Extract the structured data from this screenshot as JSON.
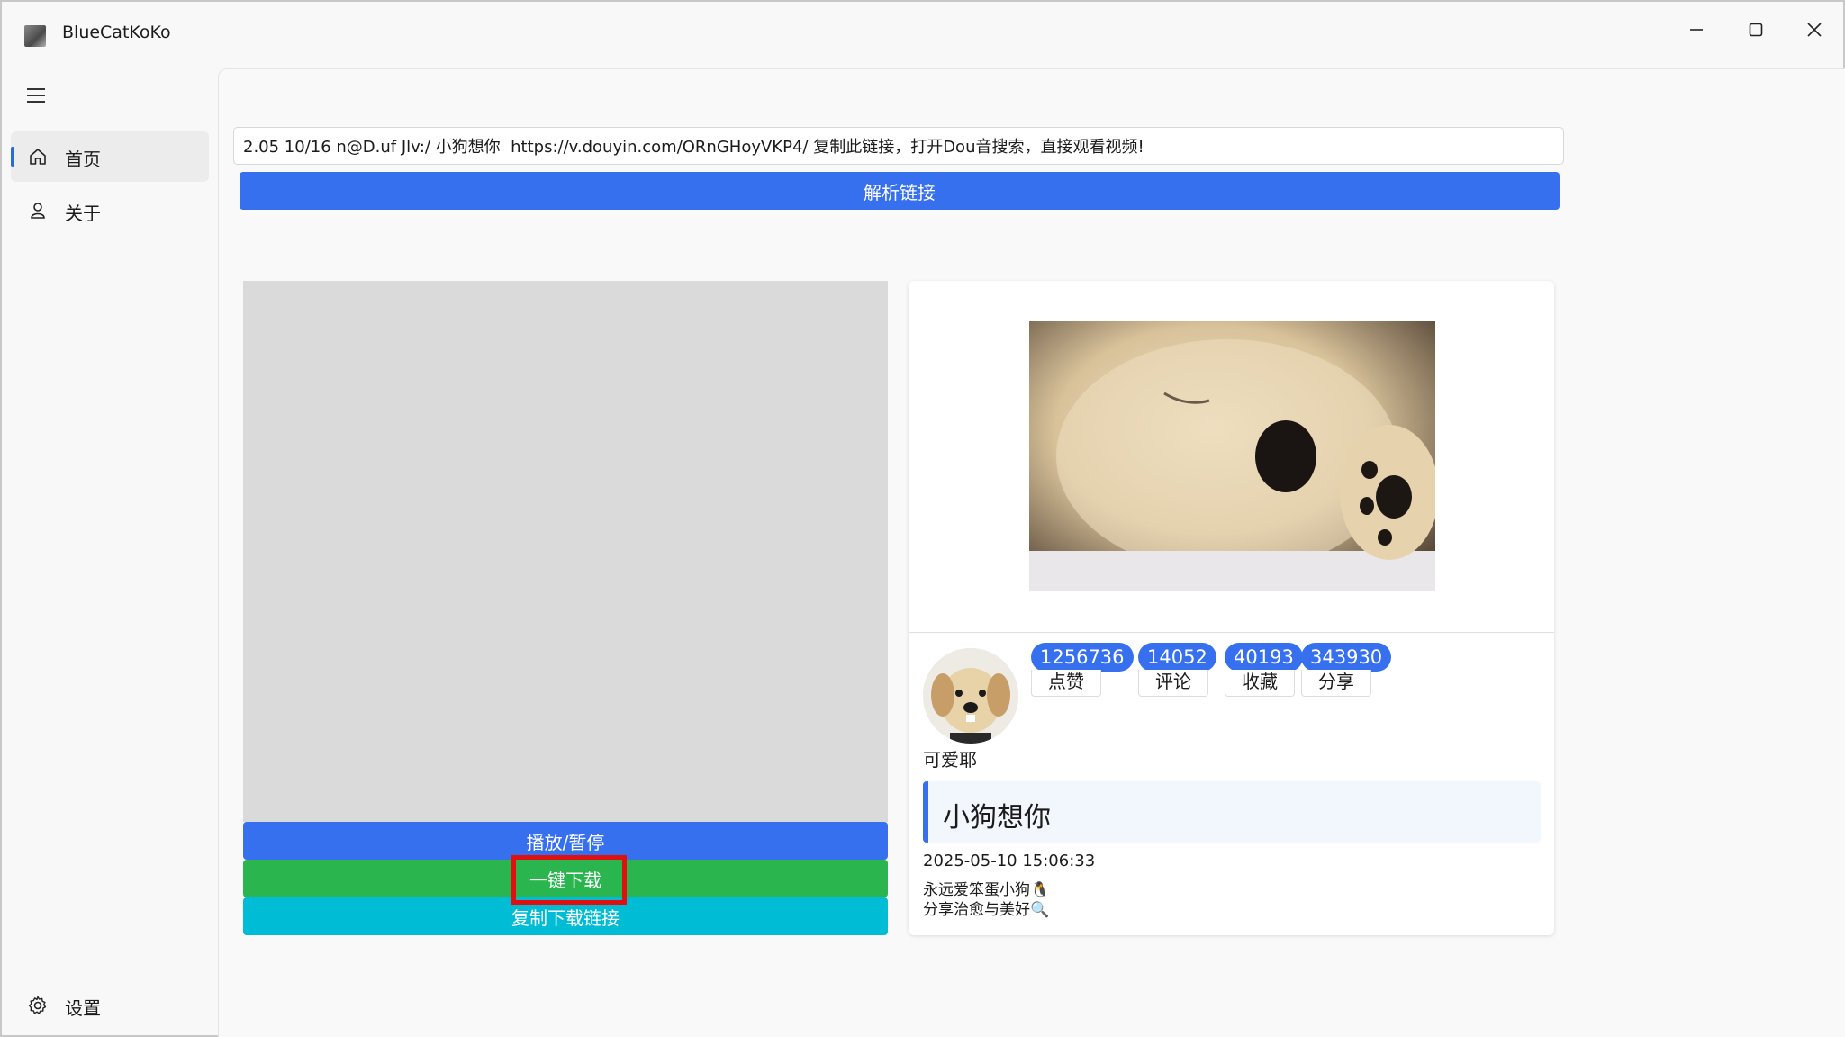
{
  "window": {
    "title": "BlueCatKoKo"
  },
  "sidebar": {
    "items": [
      {
        "label": "首页",
        "icon": "home-icon"
      },
      {
        "label": "关于",
        "icon": "person-icon"
      }
    ],
    "settings_label": "设置"
  },
  "main": {
    "url_input": {
      "value": "2.05 10/16 n@D.uf Jlv:/ 小狗想你  https://v.douyin.com/ORnGHoyVKP4/ 复制此链接，打开Dou音搜索，直接观看视频!"
    },
    "parse_button": "解析链接",
    "player": {
      "play_label": "播放/暂停",
      "download_label": "一键下载",
      "copy_label": "复制下载链接"
    },
    "card": {
      "stats": [
        {
          "value": "1256736",
          "label": "点赞"
        },
        {
          "value": "14052",
          "label": "评论"
        },
        {
          "value": "40193",
          "label": "收藏"
        },
        {
          "value": "343930",
          "label": "分享"
        }
      ],
      "author": "可爱耶",
      "title": "小狗想你",
      "time": "2025-05-10 15:06:33",
      "desc_line1": "永远爱笨蛋小狗🐧",
      "desc_line2": "分享治愈与美好🔍"
    }
  },
  "colors": {
    "primary": "#3670ee",
    "success": "#2ab54f",
    "info": "#00bcd4",
    "highlight": "#e01010"
  }
}
